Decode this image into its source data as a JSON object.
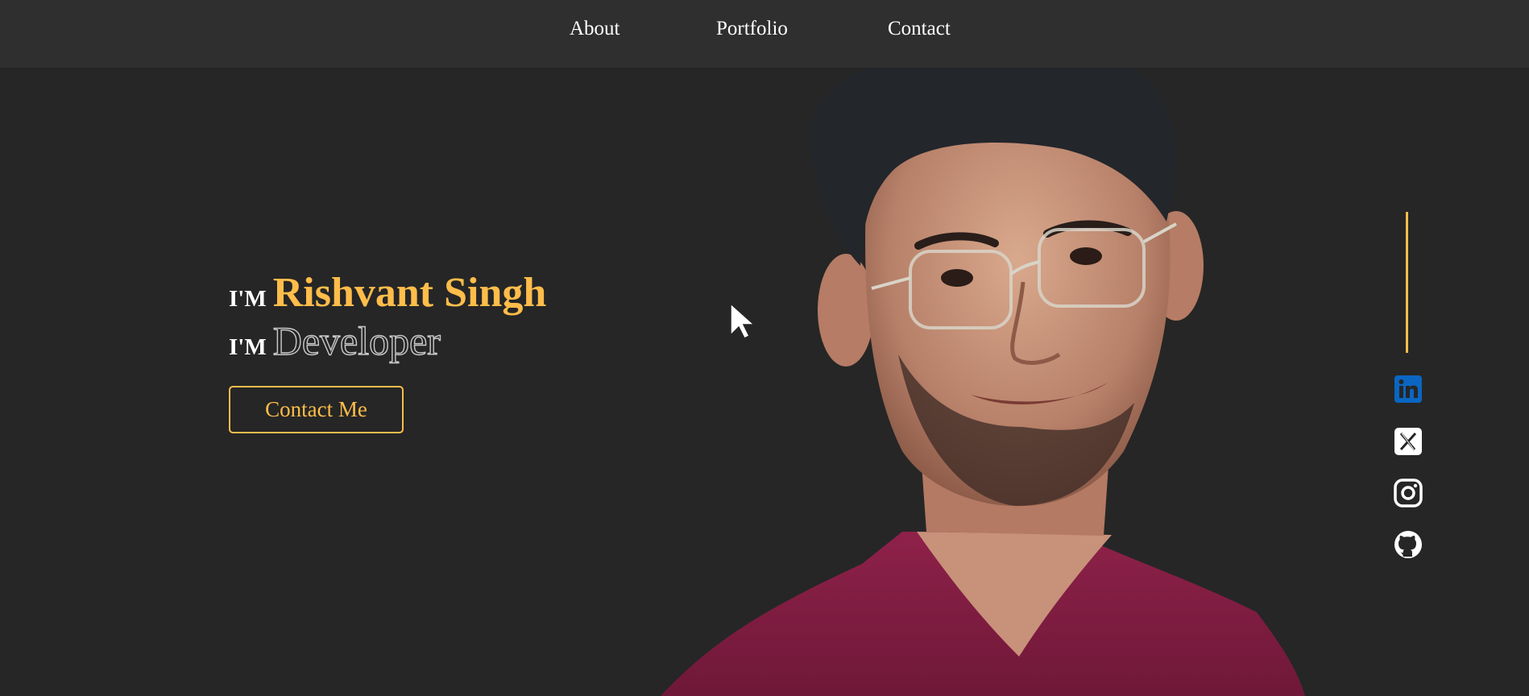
{
  "nav": {
    "items": [
      {
        "label": "About"
      },
      {
        "label": "Portfolio"
      },
      {
        "label": "Contact"
      }
    ]
  },
  "hero": {
    "prefix": "I'M",
    "name": "Rishvant Singh",
    "role": "Developer",
    "cta_label": "Contact Me"
  },
  "social": {
    "items": [
      {
        "icon": "linkedin-icon"
      },
      {
        "icon": "x-twitter-icon"
      },
      {
        "icon": "instagram-icon"
      },
      {
        "icon": "github-icon"
      }
    ]
  },
  "colors": {
    "background": "#262626",
    "navbar": "#2f2f2f",
    "accent": "#ffbd4a",
    "linkedin": "#0a66c2"
  }
}
